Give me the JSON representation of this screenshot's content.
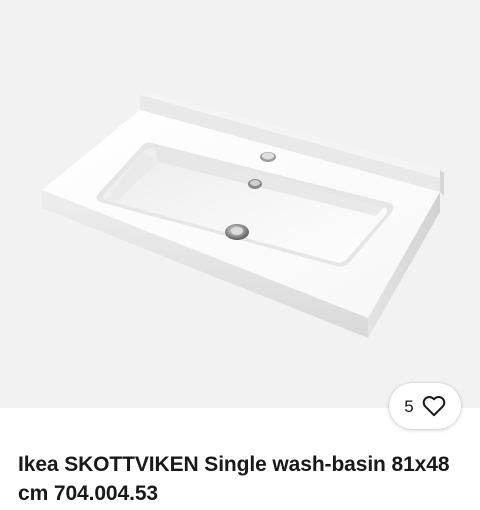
{
  "listing": {
    "title": "Ikea SKOTTVIKEN Single wash-basin 81x48 cm 704.004.53",
    "watch_count": "5",
    "image_icon": "sink-photo",
    "watch_icon": "heart-outline-icon"
  },
  "colors": {
    "image_background": "#f2f2f2",
    "text": "#191919",
    "button_background": "#ffffff"
  }
}
